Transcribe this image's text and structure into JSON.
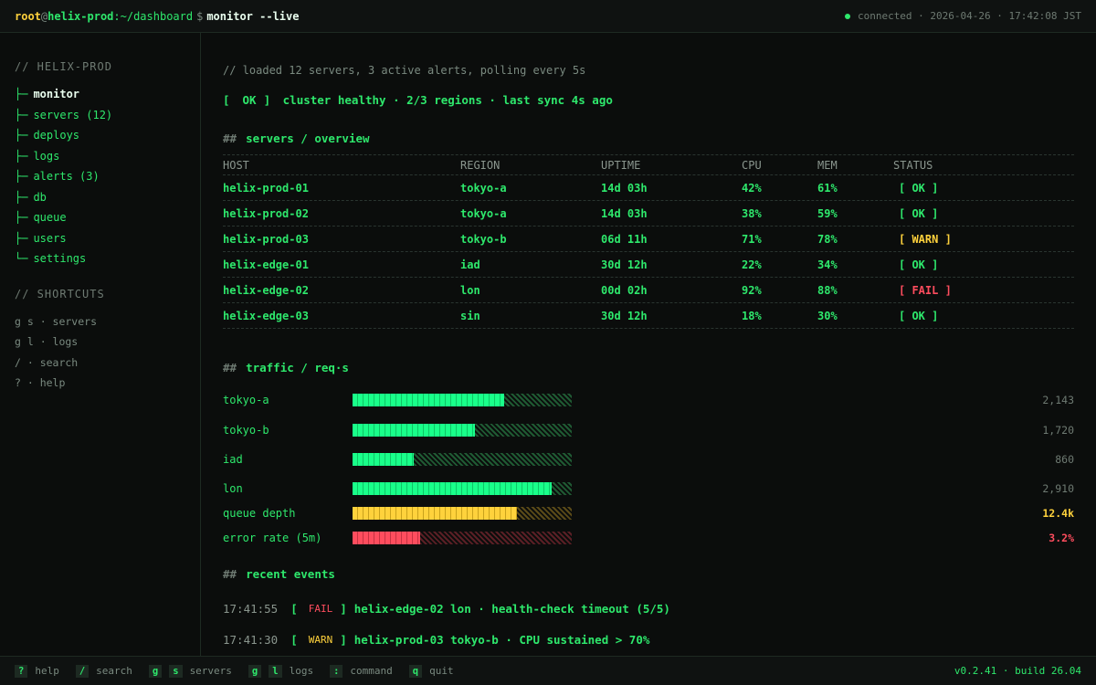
{
  "header": {
    "user": "root",
    "at": "@",
    "host": "helix-prod",
    "path": ":~/dashboard",
    "dollar": "$",
    "command": "monitor --live",
    "status": "connected · 2026-04-26 · 17:42:08 JST"
  },
  "sidebar": {
    "heading": "// HELIX-PROD",
    "items": [
      {
        "branch": "├─",
        "label": "monitor"
      },
      {
        "branch": "├─",
        "label": "servers (12)"
      },
      {
        "branch": "├─",
        "label": "deploys"
      },
      {
        "branch": "├─",
        "label": "logs"
      },
      {
        "branch": "├─",
        "label": "alerts (3)"
      },
      {
        "branch": "├─",
        "label": "db"
      },
      {
        "branch": "├─",
        "label": "queue"
      },
      {
        "branch": "├─",
        "label": "users"
      },
      {
        "branch": "└─",
        "label": "settings"
      }
    ],
    "shortcuts_heading": "// SHORTCUTS",
    "shortcuts": [
      "g s · servers",
      "g l · logs",
      "/  · search",
      "?  · help"
    ]
  },
  "main": {
    "comment": "// loaded 12 servers, 3 active alerts, polling every 5s",
    "ok_open": "[",
    "ok_label": "OK",
    "ok_close": "]",
    "ok_message": "cluster healthy · 2/3 regions · last sync 4s ago",
    "servers_hash": "##",
    "servers_title": "servers / overview",
    "table": {
      "headers": [
        "HOST",
        "REGION",
        "UPTIME",
        "CPU",
        "MEM",
        "STATUS"
      ],
      "rows": [
        [
          "helix-prod-01",
          "tokyo-a",
          "14d 03h",
          "42%",
          "61%",
          "[ OK ]"
        ],
        [
          "helix-prod-02",
          "tokyo-a",
          "14d 03h",
          "38%",
          "59%",
          "[ OK ]"
        ],
        [
          "helix-prod-03",
          "tokyo-b",
          "06d 11h",
          "71%",
          "78%",
          "[ WARN ]"
        ],
        [
          "helix-edge-01",
          "iad",
          "30d 12h",
          "22%",
          "34%",
          "[ OK ]"
        ],
        [
          "helix-edge-02",
          "lon",
          "00d 02h",
          "92%",
          "88%",
          "[ FAIL ]"
        ],
        [
          "helix-edge-03",
          "sin",
          "30d 12h",
          "18%",
          "30%",
          "[ OK ]"
        ]
      ]
    },
    "traffic_hash": "##",
    "traffic_title": "traffic / req·s",
    "traffic": [
      {
        "label": "tokyo-a",
        "value": "2,143",
        "fill": 0.69,
        "color": "green"
      },
      {
        "label": "tokyo-b",
        "value": "1,720",
        "fill": 0.56,
        "color": "green"
      },
      {
        "label": "iad",
        "value": "860",
        "fill": 0.28,
        "color": "green"
      },
      {
        "label": "lon",
        "value": "2,910",
        "fill": 0.91,
        "color": "green"
      },
      {
        "label": "queue depth",
        "value": "12.4k",
        "fill": 0.75,
        "color": "yellow"
      },
      {
        "label": "error rate (5m)",
        "value": "3.2%",
        "fill": 0.31,
        "color": "red"
      }
    ],
    "events_hash": "##",
    "events_title": "recent events",
    "events": [
      {
        "time": "17:41:55",
        "level": "FAIL",
        "message": "helix-edge-02 lon · health-check timeout (5/5)"
      },
      {
        "time": "17:41:30",
        "level": "WARN",
        "message": "helix-prod-03 tokyo-b · CPU sustained > 70%"
      }
    ]
  },
  "footer": {
    "items": [
      {
        "keys": [
          "?"
        ],
        "label": "help"
      },
      {
        "keys": [
          "/"
        ],
        "label": "search"
      },
      {
        "keys": [
          "g",
          "s"
        ],
        "label": "servers"
      },
      {
        "keys": [
          "g",
          "l"
        ],
        "label": "logs"
      },
      {
        "keys": [
          ":"
        ],
        "label": "command"
      },
      {
        "keys": [
          "q"
        ],
        "label": "quit"
      }
    ],
    "version": "v0.2.41 · build 26.04"
  },
  "colors": {
    "green": "#2ee86c",
    "yellow": "#ffd23c",
    "red": "#ff4d5e",
    "muted": "#7a8a80"
  }
}
